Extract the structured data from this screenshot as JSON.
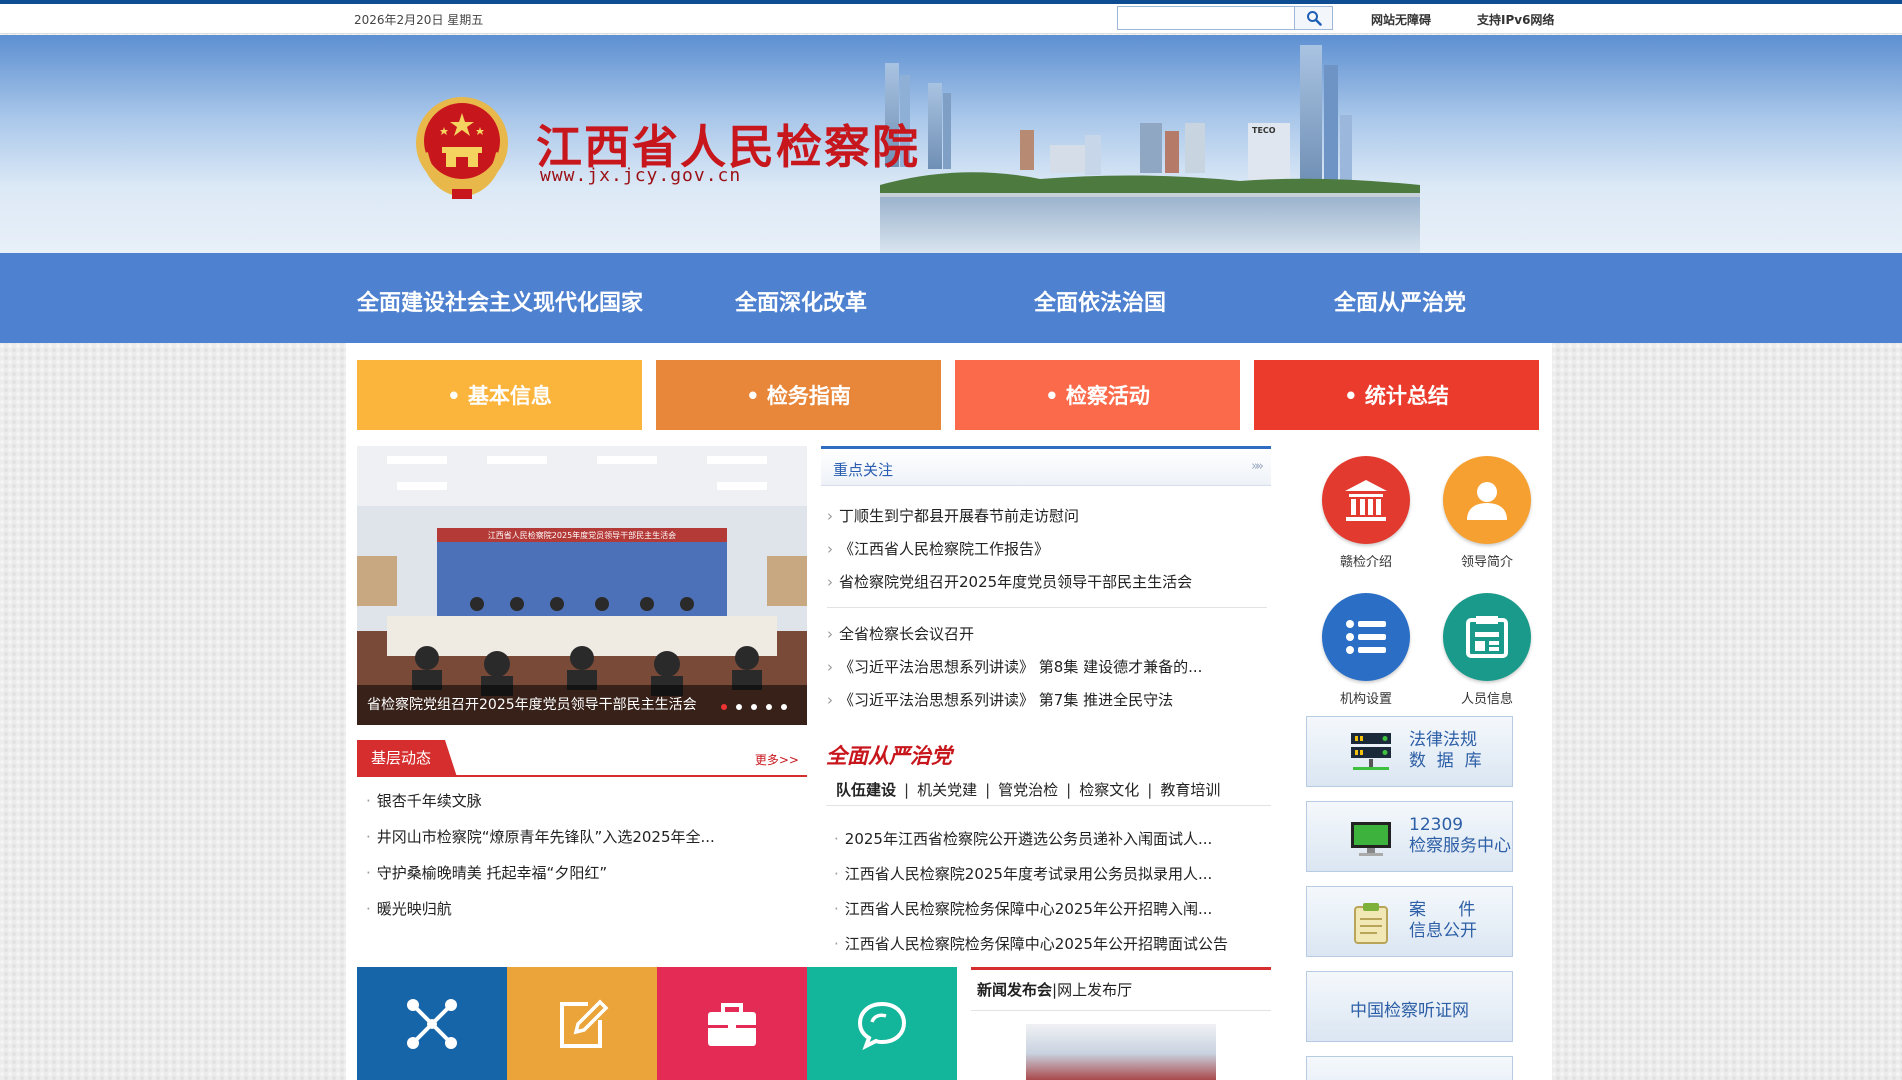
{
  "topbar": {
    "date": "2026年2月20日 星期五",
    "search_placeholder": "",
    "accessibility_label": "网站无障碍",
    "ipv6_label": "支持IPv6网络"
  },
  "banner": {
    "title": "江西省人民检察院",
    "url": "www.jx.jcy.gov.cn"
  },
  "main_nav": [
    "全面建设社会主义现代化国家",
    "全面深化改革",
    "全面依法治国",
    "全面从严治党"
  ],
  "tiles": [
    {
      "label": "• 基本信息",
      "color": "#fbb43c"
    },
    {
      "label": "• 检务指南",
      "color": "#e8863a"
    },
    {
      "label": "• 检察活动",
      "color": "#fb6a4b"
    },
    {
      "label": "• 统计总结",
      "color": "#ea3b2d"
    }
  ],
  "slideshow": {
    "caption": "省检察院党组召开2025年度党员领导干部民主生活会",
    "banner_text": "江西省人民检察院2025年度党员领导干部民主生活会",
    "active_dot": 0,
    "dot_count": 5
  },
  "focus": {
    "title": "重点关注",
    "more": "»»",
    "group1": [
      "丁顺生到宁都县开展春节前走访慰问",
      "《江西省人民检察院工作报告》",
      "省检察院党组召开2025年度党员领导干部民主生活会"
    ],
    "group2": [
      "全省检察长会议召开",
      "《习近平法治思想系列讲读》 第8集 建设德才兼备的...",
      "《习近平法治思想系列讲读》 第7集 推进全民守法"
    ]
  },
  "grassroots": {
    "title": "基层动态",
    "more": "更多>>",
    "items": [
      "银杏千年续文脉",
      "井冈山市检察院“燎原青年先锋队”入选2025年全...",
      "守护桑榆晚晴美 托起幸福“夕阳红”",
      "暖光映归航"
    ]
  },
  "party": {
    "title": "全面从严治党",
    "tabs": [
      "队伍建设",
      "机关党建",
      "管党治检",
      "检察文化",
      "教育培训"
    ],
    "items": [
      "2025年江西省检察院公开遴选公务员递补入闱面试人...",
      "江西省人民检察院2025年度考试录用公务员拟录用人...",
      "江西省人民检察院检务保障中心2025年公开招聘入闱...",
      "江西省人民检察院检务保障中心2025年公开招聘面试公告"
    ]
  },
  "bottom_tiles": [
    {
      "icon": "network-icon",
      "color": "#1565a8"
    },
    {
      "icon": "edit-icon",
      "color": "#eba43a"
    },
    {
      "icon": "briefcase-icon",
      "color": "#e42b56"
    },
    {
      "icon": "chat-icon",
      "color": "#14b69b"
    }
  ],
  "press": {
    "title": "新闻发布会",
    "sep": "|",
    "subtitle": "网上发布厅"
  },
  "right": {
    "circles": [
      {
        "label": "赣检介绍",
        "icon": "building-icon",
        "color": "#e23a2e"
      },
      {
        "label": "领导简介",
        "icon": "person-icon",
        "color": "#f5a030"
      },
      {
        "label": "机构设置",
        "icon": "list-icon",
        "color": "#2a6ec6"
      },
      {
        "label": "人员信息",
        "icon": "idcard-icon",
        "color": "#1a9a8a"
      }
    ],
    "boxes": [
      {
        "line1": "法律法规",
        "line2": "数  据  库",
        "icon": "server-icon"
      },
      {
        "line1": "12309",
        "line2": "检察服务中心",
        "icon": "monitor-icon"
      },
      {
        "line1": "案      件",
        "line2": "信息公开",
        "icon": "clipboard-icon"
      },
      {
        "center": "中国检察听证网"
      }
    ]
  }
}
